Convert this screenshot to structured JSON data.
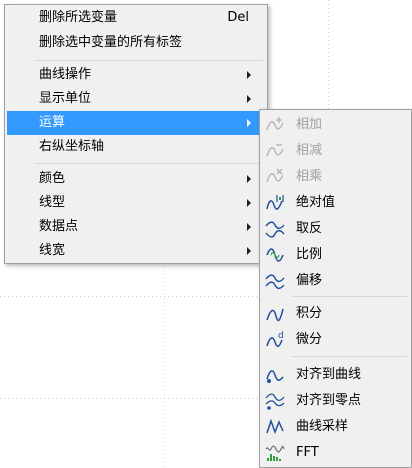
{
  "main_menu": {
    "items": [
      {
        "label": "删除所选变量",
        "shortcut": "Del"
      },
      {
        "label": "删除选中变量的所有标签"
      },
      {
        "label": "曲线操作"
      },
      {
        "label": "显示单位"
      },
      {
        "label": "运算"
      },
      {
        "label": "右纵坐标轴"
      },
      {
        "label": "颜色"
      },
      {
        "label": "线型"
      },
      {
        "label": "数据点"
      },
      {
        "label": "线宽"
      }
    ]
  },
  "submenu": {
    "items": [
      {
        "label": "相加",
        "icon": "add-curve-icon",
        "enabled": false
      },
      {
        "label": "相减",
        "icon": "subtract-curve-icon",
        "enabled": false
      },
      {
        "label": "相乘",
        "icon": "multiply-curve-icon",
        "enabled": false
      },
      {
        "label": "绝对值",
        "icon": "absolute-value-icon",
        "enabled": true
      },
      {
        "label": "取反",
        "icon": "invert-icon",
        "enabled": true
      },
      {
        "label": "比例",
        "icon": "scale-icon",
        "enabled": true
      },
      {
        "label": "偏移",
        "icon": "offset-icon",
        "enabled": true
      },
      {
        "label": "积分",
        "icon": "integral-icon",
        "enabled": true
      },
      {
        "label": "微分",
        "icon": "derivative-icon",
        "enabled": true
      },
      {
        "label": "对齐到曲线",
        "icon": "align-to-curve-icon",
        "enabled": true
      },
      {
        "label": "对齐到零点",
        "icon": "align-to-zero-icon",
        "enabled": true
      },
      {
        "label": "曲线采样",
        "icon": "curve-sampling-icon",
        "enabled": true
      },
      {
        "label": "FFT",
        "icon": "fft-icon",
        "enabled": true
      }
    ]
  },
  "colors": {
    "selection": "#3399ff",
    "menu_background": "#f0f0f0",
    "icon_blue": "#1f4e9c",
    "icon_green": "#2e9e3e"
  }
}
